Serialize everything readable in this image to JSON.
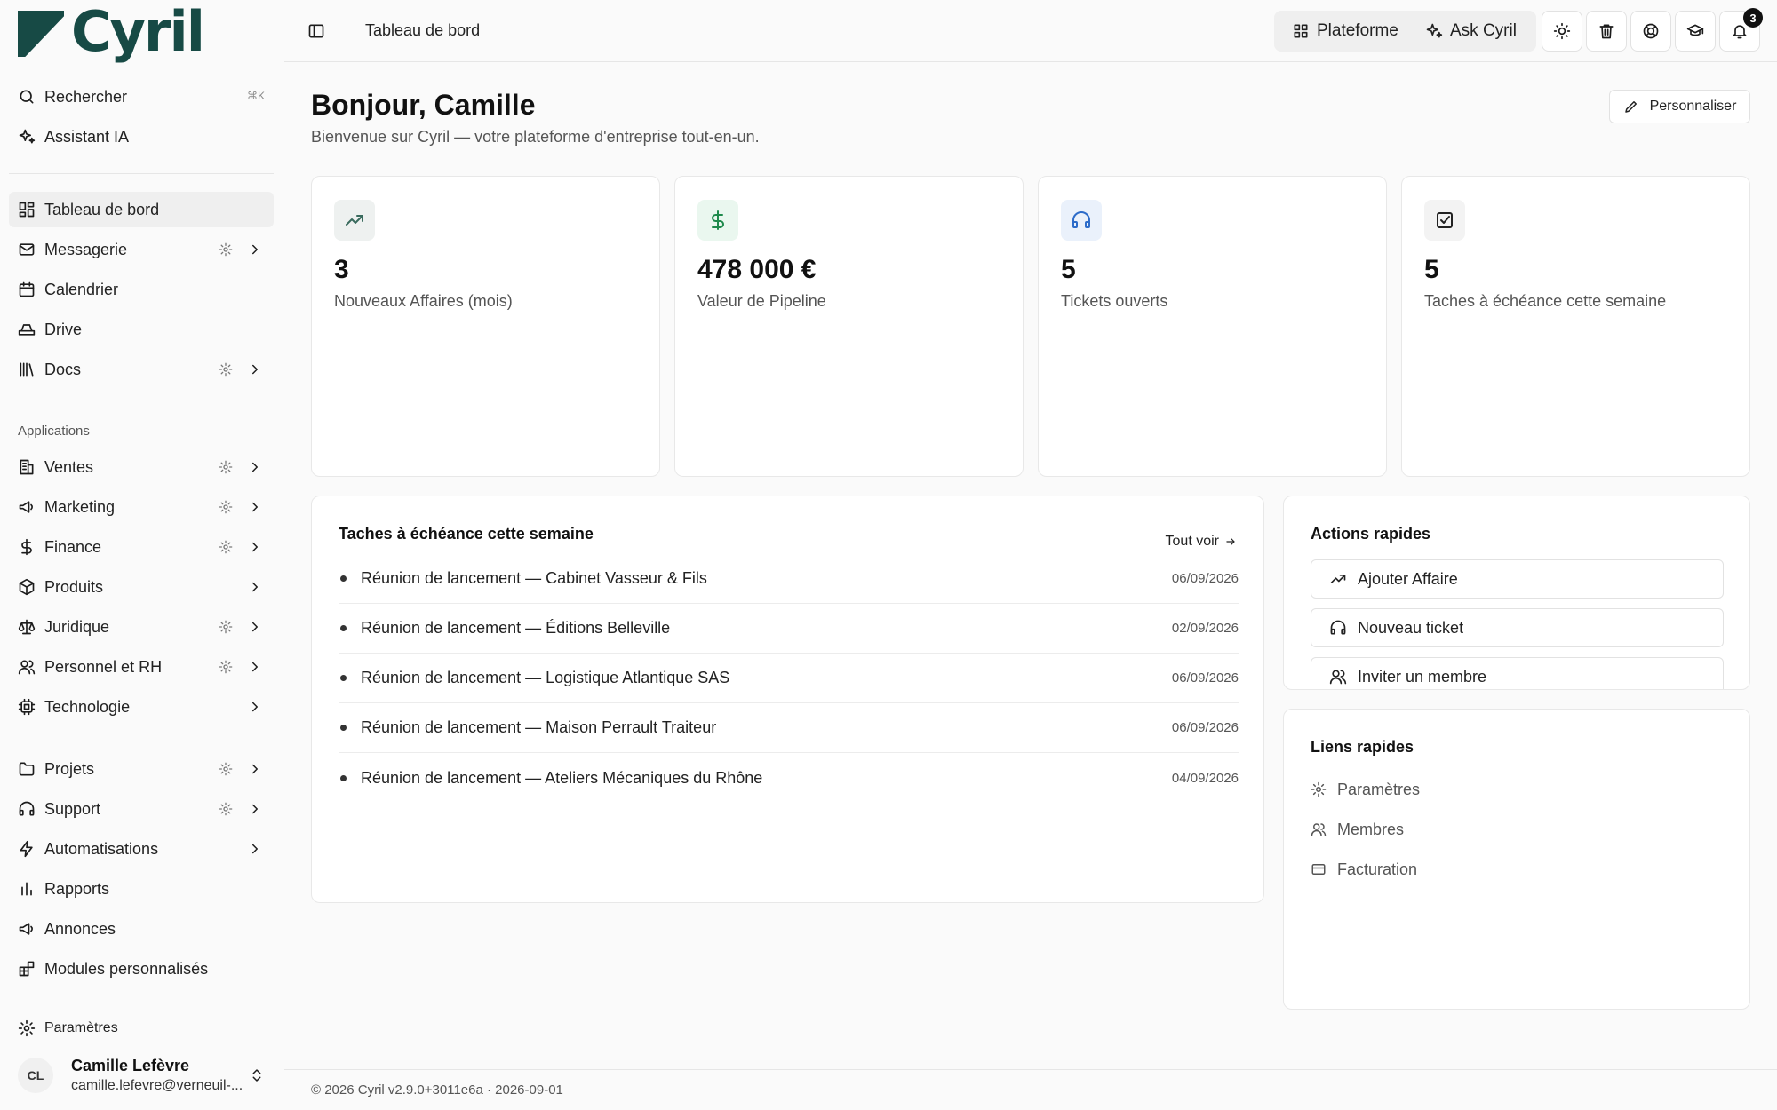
{
  "brand": {
    "name": "Cyril"
  },
  "sidebar": {
    "search": {
      "label": "Rechercher",
      "shortcut": "⌘K"
    },
    "assistant": {
      "label": "Assistant IA"
    },
    "main_items": [
      {
        "label": "Tableau de bord",
        "icon": "dashboard-icon"
      },
      {
        "label": "Messagerie",
        "icon": "mail-icon"
      },
      {
        "label": "Calendrier",
        "icon": "calendar-icon"
      },
      {
        "label": "Drive",
        "icon": "drive-icon"
      },
      {
        "label": "Docs",
        "icon": "library-icon"
      }
    ],
    "apps_title": "Applications",
    "apps": [
      {
        "label": "Ventes"
      },
      {
        "label": "Marketing"
      },
      {
        "label": "Finance"
      },
      {
        "label": "Produits"
      },
      {
        "label": "Juridique"
      },
      {
        "label": "Personnel et RH"
      },
      {
        "label": "Technologie"
      }
    ],
    "others": [
      {
        "label": "Projets"
      },
      {
        "label": "Support"
      },
      {
        "label": "Automatisations"
      },
      {
        "label": "Rapports"
      },
      {
        "label": "Annonces"
      },
      {
        "label": "Modules personnalisés"
      }
    ],
    "settings": {
      "label": "Paramètres"
    },
    "user": {
      "initials": "CL",
      "name": "Camille Lefèvre",
      "email": "camille.lefevre@verneuil-..."
    }
  },
  "topbar": {
    "breadcrumb": "Tableau de bord",
    "platform_label": "Plateforme",
    "ask_label": "Ask Cyril",
    "notifications_count": "3"
  },
  "main": {
    "greeting": "Bonjour, Camille",
    "subtitle": "Bienvenue sur Cyril — votre plateforme d'entreprise tout-en-un.",
    "customize_label": "Personnaliser",
    "stats": [
      {
        "value": "3",
        "caption": "Nouveaux Affaires (mois)",
        "icon": "trending-up-icon",
        "accent": "#3a6b5e",
        "bg": "#eef1f0"
      },
      {
        "value": "478 000 €",
        "caption": "Valeur de Pipeline",
        "icon": "dollar-icon",
        "accent": "#1f8a4c",
        "bg": "#eaf7ef"
      },
      {
        "value": "5",
        "caption": "Tickets ouverts",
        "icon": "headphones-icon",
        "accent": "#2d6cc9",
        "bg": "#eaf1fb"
      },
      {
        "value": "5",
        "caption": "Taches à échéance cette semaine",
        "icon": "check-square-icon",
        "accent": "#222222",
        "bg": "#f3f3f3"
      }
    ],
    "tasks": {
      "title": "Taches à échéance cette semaine",
      "see_all": "Tout voir",
      "items": [
        {
          "title": "Réunion de lancement — Cabinet Vasseur & Fils",
          "date": "06/09/2026"
        },
        {
          "title": "Réunion de lancement — Éditions Belleville",
          "date": "02/09/2026"
        },
        {
          "title": "Réunion de lancement — Logistique Atlantique SAS",
          "date": "06/09/2026"
        },
        {
          "title": "Réunion de lancement — Maison Perrault Traiteur",
          "date": "06/09/2026"
        },
        {
          "title": "Réunion de lancement — Ateliers Mécaniques du Rhône",
          "date": "04/09/2026"
        }
      ]
    },
    "quick_actions": {
      "title": "Actions rapides",
      "items": [
        {
          "label": "Ajouter Affaire"
        },
        {
          "label": "Nouveau ticket"
        },
        {
          "label": "Inviter un membre"
        }
      ]
    },
    "quick_links": {
      "title": "Liens rapides",
      "items": [
        {
          "label": "Paramètres"
        },
        {
          "label": "Membres"
        },
        {
          "label": "Facturation"
        }
      ]
    }
  },
  "footer": {
    "text": "© 2026 Cyril v2.9.0+3011e6a · 2026-09-01"
  }
}
